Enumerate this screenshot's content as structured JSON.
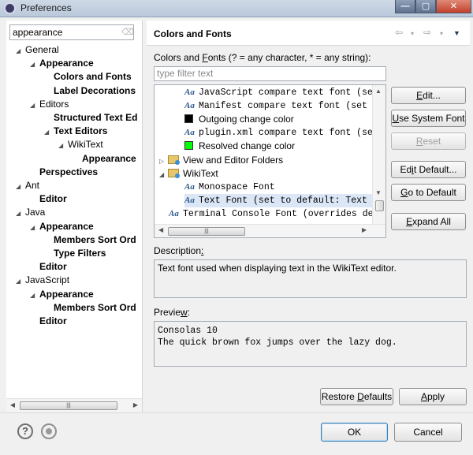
{
  "window": {
    "title": "Preferences",
    "min": "—",
    "max": "▢",
    "close": "✕"
  },
  "left": {
    "filter_value": "appearance",
    "clear_icon": "eraser-icon",
    "tree": [
      {
        "label": "General",
        "arrow": "◢",
        "bold": false
      },
      {
        "label": "Appearance",
        "arrow": "◢",
        "bold": true
      },
      {
        "label": "Colors and Fonts",
        "arrow": "",
        "bold": true
      },
      {
        "label": "Label Decorations",
        "arrow": "",
        "bold": true
      },
      {
        "label": "Editors",
        "arrow": "◢",
        "bold": false
      },
      {
        "label": "Structured Text Ed",
        "arrow": "",
        "bold": true
      },
      {
        "label": "Text Editors",
        "arrow": "◢",
        "bold": true
      },
      {
        "label": "WikiText",
        "arrow": "◢",
        "bold": false
      },
      {
        "label": "Appearance",
        "arrow": "",
        "bold": true
      },
      {
        "label": "Perspectives",
        "arrow": "",
        "bold": true
      },
      {
        "label": "Ant",
        "arrow": "◢",
        "bold": false
      },
      {
        "label": "Editor",
        "arrow": "",
        "bold": true
      },
      {
        "label": "Java",
        "arrow": "◢",
        "bold": false
      },
      {
        "label": "Appearance",
        "arrow": "◢",
        "bold": true
      },
      {
        "label": "Members Sort Ord",
        "arrow": "",
        "bold": true
      },
      {
        "label": "Type Filters",
        "arrow": "",
        "bold": true
      },
      {
        "label": "Editor",
        "arrow": "",
        "bold": true
      },
      {
        "label": "JavaScript",
        "arrow": "◢",
        "bold": false
      },
      {
        "label": "Appearance",
        "arrow": "◢",
        "bold": true
      },
      {
        "label": "Members Sort Ord",
        "arrow": "",
        "bold": true
      },
      {
        "label": "Editor",
        "arrow": "",
        "bold": true
      }
    ]
  },
  "header": {
    "title": "Colors and Fonts",
    "back_icon": "⇦",
    "menu_icon": "▾",
    "forward_icon": "⇨",
    "view_menu_icon": "▼"
  },
  "main": {
    "subtitle_pre": "Colors and ",
    "subtitle_mn": "F",
    "subtitle_post": "onts (? = any character, * = any string):",
    "filter_placeholder": "type filter text",
    "items": [
      {
        "kind": "font",
        "text": "JavaScript compare text font (set to",
        "mono": true,
        "selected": false
      },
      {
        "kind": "font",
        "text": "Manifest compare text font (set to",
        "mono": true,
        "selected": false
      },
      {
        "kind": "color",
        "text": "Outgoing change color",
        "mono": false,
        "color": "#000000",
        "selected": false
      },
      {
        "kind": "font",
        "text": "plugin.xml compare text font (set to",
        "mono": true,
        "selected": false
      },
      {
        "kind": "color",
        "text": "Resolved change color",
        "mono": false,
        "color": "#00ff00",
        "selected": false
      },
      {
        "kind": "folder",
        "text": "View and Editor Folders",
        "arrow": "▷",
        "mono": false,
        "selected": false
      },
      {
        "kind": "folder",
        "text": "WikiText",
        "arrow": "◢",
        "mono": false,
        "selected": false
      },
      {
        "kind": "font",
        "text": "Monospace Font",
        "mono": true,
        "selected": false
      },
      {
        "kind": "font",
        "text": "Text Font (set to default: Text Fo",
        "mono": true,
        "selected": true
      },
      {
        "kind": "font",
        "text": "Terminal Console Font (overrides def",
        "mono": true,
        "selected": false
      }
    ],
    "buttons": {
      "edit_pre": "",
      "edit_mn": "E",
      "edit_post": "dit...",
      "use_system_pre": "",
      "use_system_mn": "U",
      "use_system_post": "se System Font",
      "reset_pre": "",
      "reset_mn": "R",
      "reset_post": "eset",
      "edit_default_pre": "Ed",
      "edit_default_mn": "i",
      "edit_default_post": "t Default...",
      "goto_default_pre": "",
      "goto_default_mn": "G",
      "goto_default_post": "o to Default",
      "expand_all_pre": "",
      "expand_all_mn": "E",
      "expand_all_post": "xpand All"
    },
    "description_label_pre": "Description",
    "description_label_mn": ":",
    "description_text": "Text font used when displaying text in the WikiText editor.",
    "preview_label_pre": "Previe",
    "preview_label_mn": "w",
    "preview_label_post": ":",
    "preview_line1": "Consolas 10",
    "preview_line2": "The quick brown fox jumps over the lazy dog.",
    "restore_pre": "Restore ",
    "restore_mn": "D",
    "restore_post": "efaults",
    "apply_pre": "",
    "apply_mn": "A",
    "apply_post": "pply"
  },
  "footer": {
    "ok": "OK",
    "cancel": "Cancel",
    "help_icon": "?"
  }
}
